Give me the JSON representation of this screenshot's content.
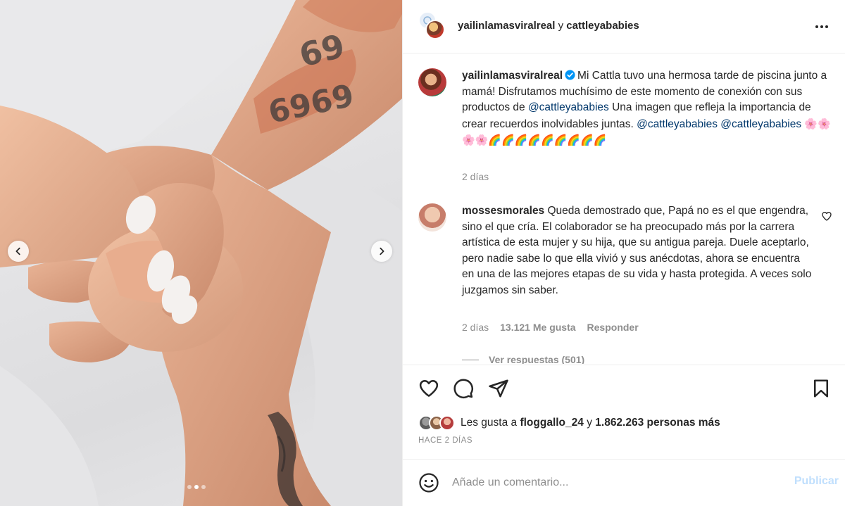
{
  "post": {
    "header": {
      "author": "yailinlamasviralreal",
      "conjunction": "y",
      "collaborator": "cattleyababies"
    },
    "caption": {
      "username": "yailinlamasviralreal",
      "text_1": "Mi Cattla tuvo una hermosa tarde de piscina junto a mamá! Disfrutamos muchísimo de este momento de conexión con sus productos de ",
      "mention_1": "@cattleyababies",
      "text_2": " Una imagen que refleja la importancia de crear recuerdos inolvidables juntas. ",
      "mention_2": "@cattleyababies",
      "mention_3": "@cattleyababies",
      "emojis": "🌸🌸🌸🌸🌈🌈🌈🌈🌈🌈🌈🌈🌈",
      "time": "2 días"
    },
    "comment": {
      "username": "mossesmorales",
      "text": "Queda demostrado que, Papá no es el que engendra, sino el que cría. El colaborador se ha preocupado más por la carrera artística de esta mujer y su hija, que su antigua pareja. Duele aceptarlo, pero nadie sabe lo que ella vivió y sus anécdotas, ahora se encuentra en una de las mejores etapas de su vida y hasta protegida. A veces solo juzgamos sin saber.",
      "time": "2 días",
      "likes": "13.121 Me gusta",
      "reply": "Responder",
      "view_replies": "Ver respuestas (501)"
    },
    "likes": {
      "prefix": "Les gusta a ",
      "first_user": "floggallo_24",
      "middle": " y ",
      "others": "1.862.263 personas más"
    },
    "date": "HACE 2 DÍAS",
    "add_comment": {
      "placeholder": "Añade un comentario...",
      "publish": "Publicar"
    }
  },
  "carousel": {
    "slide_count": 3,
    "active_slide": 2
  },
  "colors": {
    "text": "#262626",
    "muted": "#8e8e8e",
    "mention": "#00376b",
    "publish_disabled": "#c0dffd",
    "verified": "#0095f6"
  },
  "icons": [
    "chevron-left-icon",
    "chevron-right-icon",
    "more-icon",
    "verified-icon",
    "heart-icon",
    "comment-icon",
    "share-icon",
    "bookmark-icon",
    "emoji-icon"
  ]
}
